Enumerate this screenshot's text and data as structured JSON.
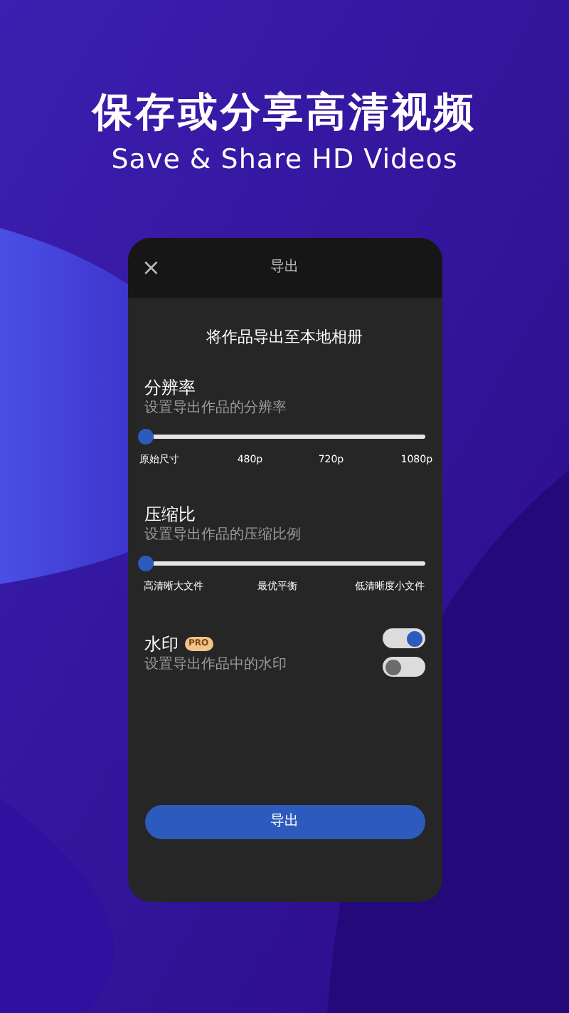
{
  "headline": "保存或分享高清视频",
  "subheadline": "Save & Share HD Videos",
  "dialog": {
    "title": "导出",
    "close": "×",
    "heading": "将作品导出至本地相册",
    "settings": [
      {
        "kind": "slider",
        "title": "分辨率",
        "description": "设置导出作品的分辨率",
        "level": 0,
        "ticks": [
          "原始尺寸",
          "480p",
          "720p",
          "1080p"
        ]
      },
      {
        "kind": "slider",
        "title": "压缩比",
        "description": "设置导出作品的压缩比例",
        "level": 0,
        "ticks": [
          "高清晰大文件",
          "最优平衡",
          "低清晰度小文件"
        ]
      },
      {
        "kind": "toggle",
        "title": "水印",
        "badge": "PRO",
        "description": "设置导出作品中的水印",
        "toggles": [
          {
            "on": true
          },
          {
            "on": false
          }
        ]
      }
    ],
    "button": "导出"
  }
}
